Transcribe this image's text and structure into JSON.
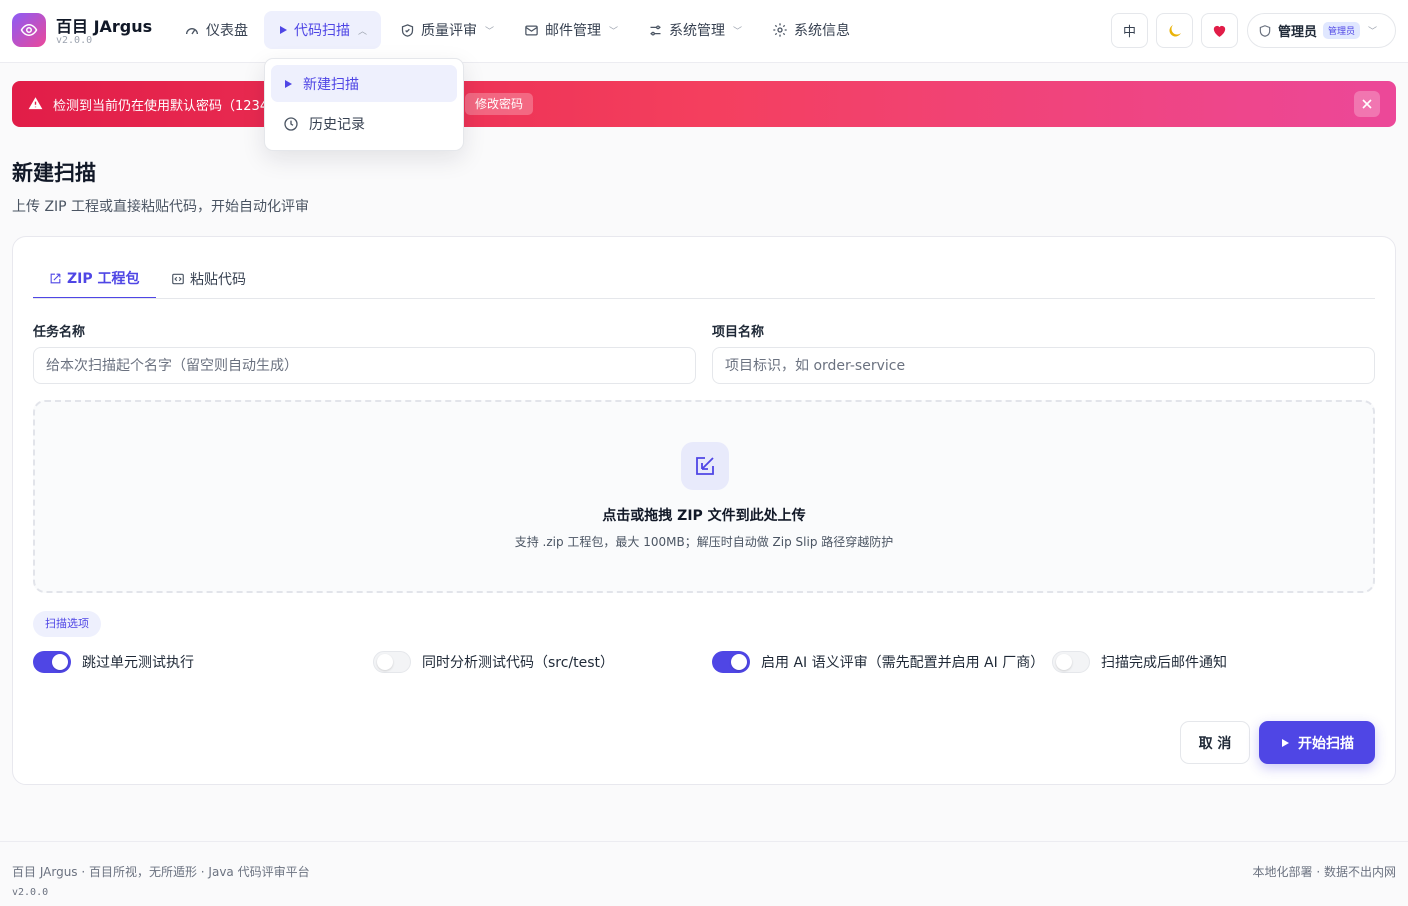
{
  "brand": {
    "name": "百目 JArgus",
    "version": "v2.0.0"
  },
  "nav": {
    "dashboard": "仪表盘",
    "code_scan": "代码扫描",
    "quality_review": "质量评审",
    "mail_management": "邮件管理",
    "system_management": "系统管理",
    "system_info": "系统信息"
  },
  "header": {
    "lang": "中",
    "user_name": "管理员",
    "user_role": "管理员"
  },
  "alert": {
    "text": "检测到当前仍在使用默认密码（123456）",
    "action": "修改密码"
  },
  "dropdown": {
    "items": [
      {
        "label": "新建扫描"
      },
      {
        "label": "历史记录"
      }
    ]
  },
  "page": {
    "title": "新建扫描",
    "subtitle": "上传 ZIP 工程或直接粘贴代码，开始自动化评审"
  },
  "tabs": [
    {
      "label": "ZIP 工程包"
    },
    {
      "label": "粘贴代码"
    }
  ],
  "form": {
    "task_name": {
      "label": "任务名称",
      "value": "",
      "placeholder": "给本次扫描起个名字（留空则自动生成）"
    },
    "project_name": {
      "label": "项目名称",
      "value": "",
      "placeholder": "项目标识，如 order-service"
    }
  },
  "upload": {
    "title": "点击或拖拽 ZIP 文件到此处上传",
    "hint": "支持 .zip 工程包，最大 100MB；解压时自动做 Zip Slip 路径穿越防护"
  },
  "options": {
    "badge": "扫描选项",
    "toggles": [
      {
        "label": "跳过单元测试执行",
        "on": true
      },
      {
        "label": "同时分析测试代码（src/test）",
        "on": false
      },
      {
        "label": "启用 AI 语义评审（需先配置并启用 AI 厂商）",
        "on": true
      },
      {
        "label": "扫描完成后邮件通知",
        "on": false
      }
    ]
  },
  "actions": {
    "cancel": "取 消",
    "start": "开始扫描"
  },
  "footer": {
    "left": "百目 JArgus · 百目所视，无所遁形 · Java 代码评审平台",
    "version": "v2.0.0",
    "right": "本地化部署 · 数据不出内网"
  },
  "colors": {
    "primary": "#4f46e5",
    "danger": "#e11d48",
    "heart": "#e11d48",
    "moon": "#eab308"
  }
}
